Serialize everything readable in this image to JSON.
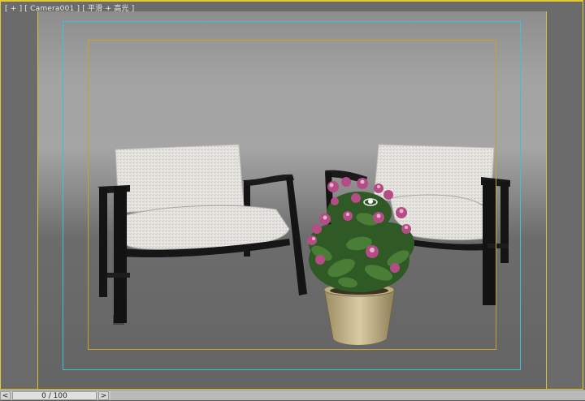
{
  "viewport": {
    "label": "[ + ] [ Camera001 ] [ 平滑 + 高光 ]",
    "camera": "Camera001",
    "shading_mode": "平滑 + 高光"
  },
  "timeline": {
    "frame_display": "0 / 100",
    "prev_label": "<",
    "next_label": ">"
  },
  "scene_objects": [
    "armchair-left",
    "armchair-right",
    "potted-flower-plant"
  ],
  "colors": {
    "viewport_active_border": "#e6c832",
    "render_frame": "#d9c040",
    "safe_frame_outer": "#3cc2d6",
    "safe_frame_inner": "#c8a030"
  }
}
